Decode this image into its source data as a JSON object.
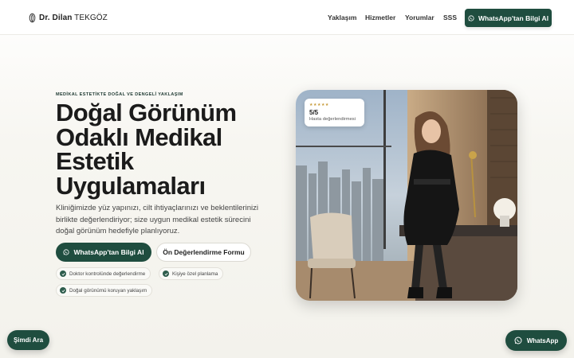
{
  "brand": {
    "prefix": "Dr. Dilan",
    "surname": "TEKGÖZ"
  },
  "nav": {
    "items": [
      "Yaklaşım",
      "Hizmetler",
      "Yorumlar",
      "SSS"
    ],
    "cta_label": "WhatsApp'tan Bilgi Al"
  },
  "hero": {
    "eyebrow": "MEDİKAL ESTETİKTE DOĞAL VE DENGELİ YAKLAŞIM",
    "headline_lines": [
      "Doğal Görünüm",
      "Odaklı Medikal",
      "Estetik",
      "Uygulamaları"
    ],
    "lead": "Kliniğimizde yüz yapınızı, cilt ihtiyaçlarınızı ve beklentilerinizi birlikte değerlendiriyor; size uygun medikal estetik sürecini doğal görünüm hedefiyle planlıyoruz.",
    "primary_button": "WhatsApp'tan Bilgi Al",
    "secondary_button": "Ön Değerlendirme Formu",
    "chips": [
      "Doktor kontrolünde değerlendirme",
      "Kişiye özel planlama",
      "Doğal görünümü koruyan yaklaşım"
    ]
  },
  "rating": {
    "stars": "★★★★★",
    "score": "5/5",
    "label": "Hasta değerlendirmesi"
  },
  "floating": {
    "call_label": "Şimdi Ara",
    "whatsapp_label": "WhatsApp"
  },
  "colors": {
    "accent": "#1f4d3f",
    "background": "#f5f4ef",
    "star": "#c79a3a"
  },
  "icons": {
    "logo": "logo-mark-icon",
    "whatsapp": "whatsapp-icon",
    "check": "check-icon"
  }
}
